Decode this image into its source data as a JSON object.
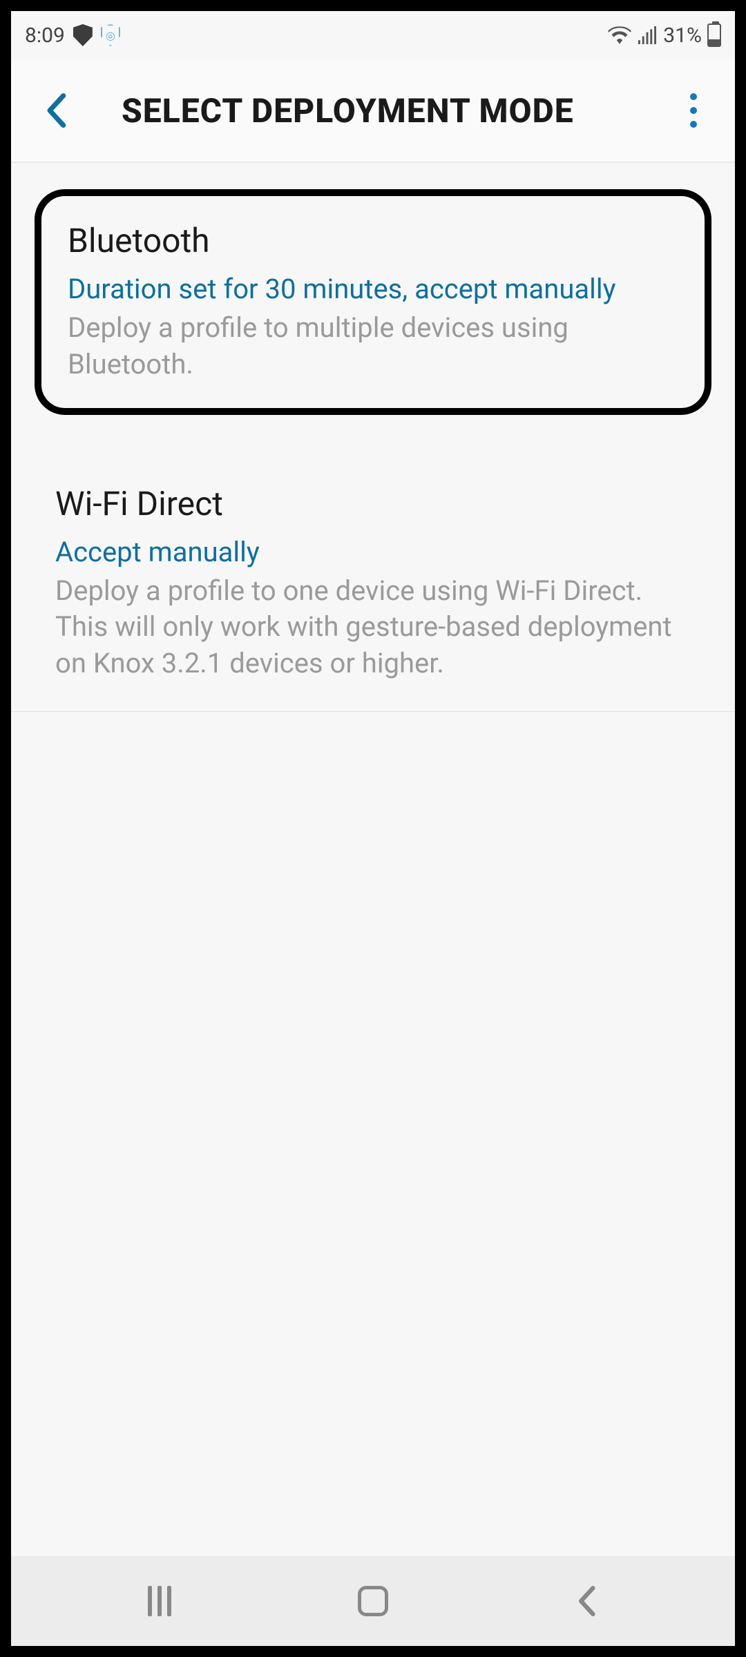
{
  "status": {
    "time": "8:09",
    "battery_pct": "31%"
  },
  "header": {
    "title": "SELECT DEPLOYMENT MODE"
  },
  "options": [
    {
      "title": "Bluetooth",
      "subtitle": "Duration set for 30 minutes, accept manually",
      "description": "Deploy a profile to multiple devices using Bluetooth."
    },
    {
      "title": "Wi-Fi Direct",
      "subtitle": "Accept manually",
      "description": "Deploy a profile to one device using Wi-Fi Direct. This will only work with gesture-based deployment on Knox 3.2.1 devices or higher."
    }
  ],
  "colors": {
    "accent": "#0e6f9e"
  }
}
